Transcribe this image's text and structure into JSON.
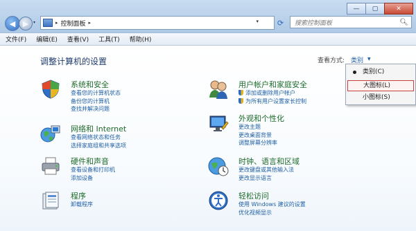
{
  "window": {
    "minimize_glyph": "—",
    "maximize_glyph": "▢",
    "close_glyph": "✕"
  },
  "address_bar": {
    "separator": "▸",
    "path": [
      "控制面板"
    ],
    "dropdown_glyph": "▾",
    "refresh_glyph": "⟳",
    "back_glyph": "◀",
    "forward_glyph": "▶"
  },
  "search": {
    "placeholder": "搜索控制面板",
    "icon": "search-icon"
  },
  "menu": {
    "items": [
      "文件(F)",
      "编辑(E)",
      "查看(V)",
      "工具(T)",
      "帮助(H)"
    ]
  },
  "page": {
    "title": "调整计算机的设置",
    "view_label": "查看方式:",
    "view_value": "类别",
    "view_drop_glyph": "▼"
  },
  "categories": [
    {
      "title": "系统和安全",
      "icon": "shield-icon",
      "links": [
        "查看您的计算机状态",
        "备份您的计算机",
        "查找并解决问题"
      ]
    },
    {
      "title": "网络和 Internet",
      "icon": "network-globe-icon",
      "links": [
        "查看网络状态和任务",
        "选择家庭组和共享选项"
      ]
    },
    {
      "title": "硬件和声音",
      "icon": "printer-icon",
      "links": [
        "查看设备和打印机",
        "添加设备"
      ]
    },
    {
      "title": "程序",
      "icon": "programs-icon",
      "links": [
        "卸载程序"
      ]
    },
    {
      "title": "用户帐户和家庭安全",
      "icon": "users-icon",
      "links": [
        "添加或删除用户帐户",
        "为所有用户设置家长控制"
      ],
      "shield_links": [
        0,
        1
      ]
    },
    {
      "title": "外观和个性化",
      "icon": "display-icon",
      "links": [
        "更改主题",
        "更改桌面背景",
        "调整屏幕分辨率"
      ]
    },
    {
      "title": "时钟、语言和区域",
      "icon": "clock-globe-icon",
      "links": [
        "更改键盘或其他输入法",
        "更改显示语言"
      ]
    },
    {
      "title": "轻松访问",
      "icon": "ease-of-access-icon",
      "links": [
        "使用 Windows 建议的设置",
        "优化视频显示"
      ]
    }
  ],
  "view_menu": {
    "items": [
      "类别(C)",
      "大图标(L)",
      "小图标(S)"
    ],
    "selected": "类别(C)",
    "highlighted": "大图标(L)"
  },
  "colors": {
    "category_title": "#1e6b2a",
    "link": "#1f5fa5",
    "page_title": "#1e3a6c",
    "highlight_border": "#c94040"
  }
}
